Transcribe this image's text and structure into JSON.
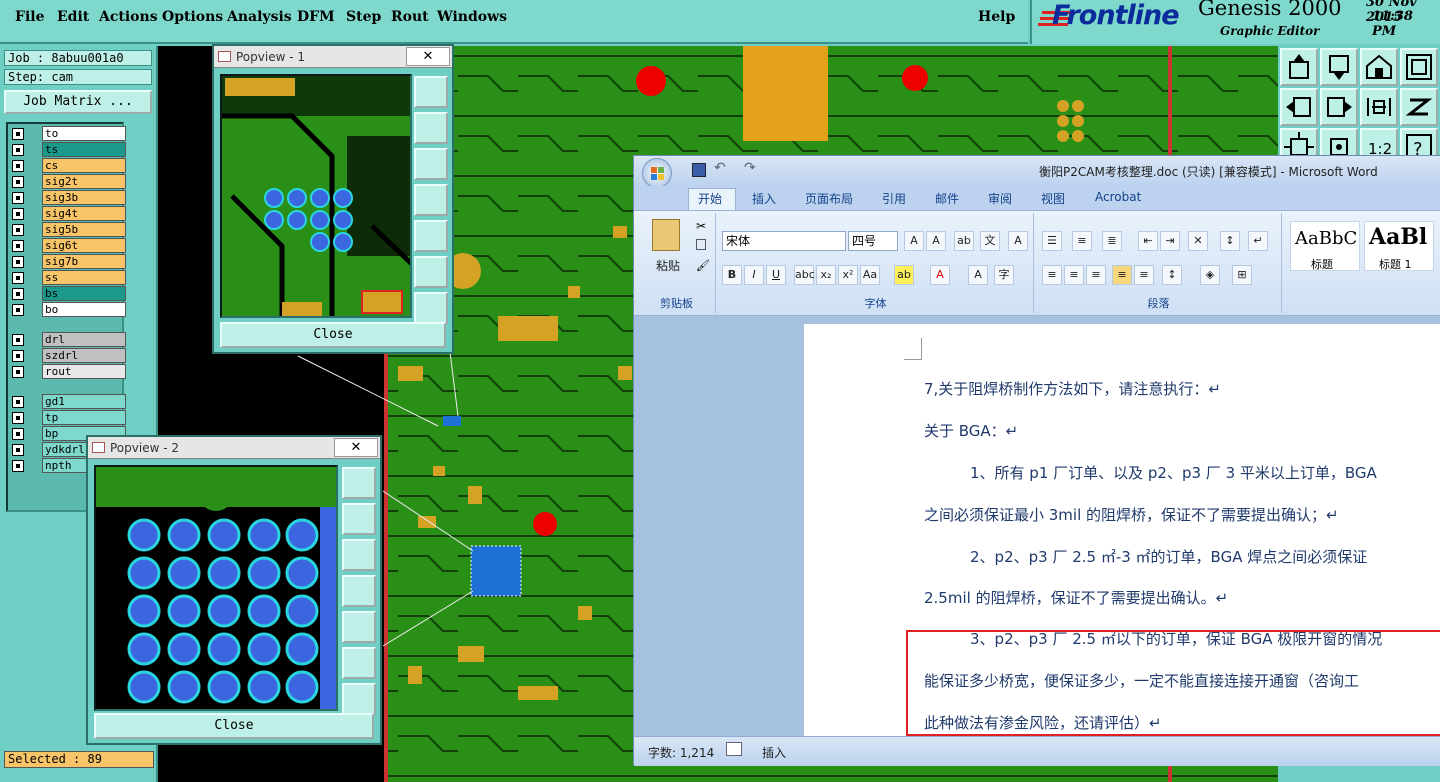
{
  "menu": [
    "File",
    "Edit",
    "Actions",
    "Options",
    "Analysis",
    "DFM",
    "Step",
    "Rout",
    "Windows"
  ],
  "help": "Help",
  "brand": {
    "logo": "Frontline",
    "product": "Genesis 2000",
    "editor": "Graphic Editor",
    "date": "30 Nov 2015",
    "time": "11:38 PM"
  },
  "job": "Job : 8abuu001a0",
  "step": "Step: cam",
  "job_matrix": "Job Matrix ...",
  "layers_group1": [
    {
      "name": "to",
      "color": "#ffffff"
    },
    {
      "name": "ts",
      "color": "#1b9a8c"
    },
    {
      "name": "cs",
      "color": "#f7c468"
    },
    {
      "name": "sig2t",
      "color": "#f7c468"
    },
    {
      "name": "sig3b",
      "color": "#f7c468"
    },
    {
      "name": "sig4t",
      "color": "#f7c468"
    },
    {
      "name": "sig5b",
      "color": "#f7c468"
    },
    {
      "name": "sig6t",
      "color": "#f7c468"
    },
    {
      "name": "sig7b",
      "color": "#f7c468"
    },
    {
      "name": "ss",
      "color": "#f7c468"
    },
    {
      "name": "bs",
      "color": "#1b9a8c"
    },
    {
      "name": "bo",
      "color": "#ffffff"
    }
  ],
  "layers_group2": [
    {
      "name": "drl",
      "color": "#c0c0c0"
    },
    {
      "name": "szdrl",
      "color": "#c0c0c0"
    },
    {
      "name": "rout",
      "color": "#e8e8e8"
    }
  ],
  "layers_group3": [
    {
      "name": "gd1",
      "color": "#7fd8cc"
    },
    {
      "name": "tp",
      "color": "#7fd8cc"
    },
    {
      "name": "bp",
      "color": "#7fd8cc"
    },
    {
      "name": "ydkdrl",
      "color": "#7fd8cc"
    },
    {
      "name": "npth",
      "color": "#7fd8cc"
    }
  ],
  "selected": "Selected : 89",
  "popview1": {
    "title": "Popview - 1",
    "close": "Close"
  },
  "popview2": {
    "title": "Popview - 2",
    "close": "Close"
  },
  "word": {
    "title": "衡阳P2CAM考核整理.doc (只读) [兼容模式] - Microsoft Word",
    "tabs": [
      "开始",
      "插入",
      "页面布局",
      "引用",
      "邮件",
      "审阅",
      "视图",
      "Acrobat"
    ],
    "paste": "粘贴",
    "clipboard": "剪贴板",
    "font_name": "宋体",
    "font_size": "四号",
    "font_group": "字体",
    "para_group": "段落",
    "styles": [
      {
        "preview": "AaBbC",
        "name": "标题"
      },
      {
        "preview": "AaBl",
        "name": "标题 1"
      }
    ],
    "lines": [
      "7,关于阻焊桥制作方法如下，请注意执行：↵",
      "关于 BGA：↵",
      "1、所有 p1 厂订单、以及 p2、p3 厂 3 平米以上订单，BGA",
      "之间必须保证最小 3mil 的阻焊桥，保证不了需要提出确认；↵",
      "2、p2、p3 厂 2.5 ㎡-3 ㎡的订单，BGA 焊点之间必须保证",
      "2.5mil 的阻焊桥，保证不了需要提出确认。↵",
      "3、p2、p3 厂 2.5 ㎡以下的订单，保证 BGA 极限开窗的情况",
      "能保证多少桥宽，便保证多少，一定不能直接连接开通窗（咨询工",
      "此种做法有渗金风险，还请评估）↵"
    ],
    "status_words": "字数: 1,214",
    "status_insert": "插入"
  }
}
